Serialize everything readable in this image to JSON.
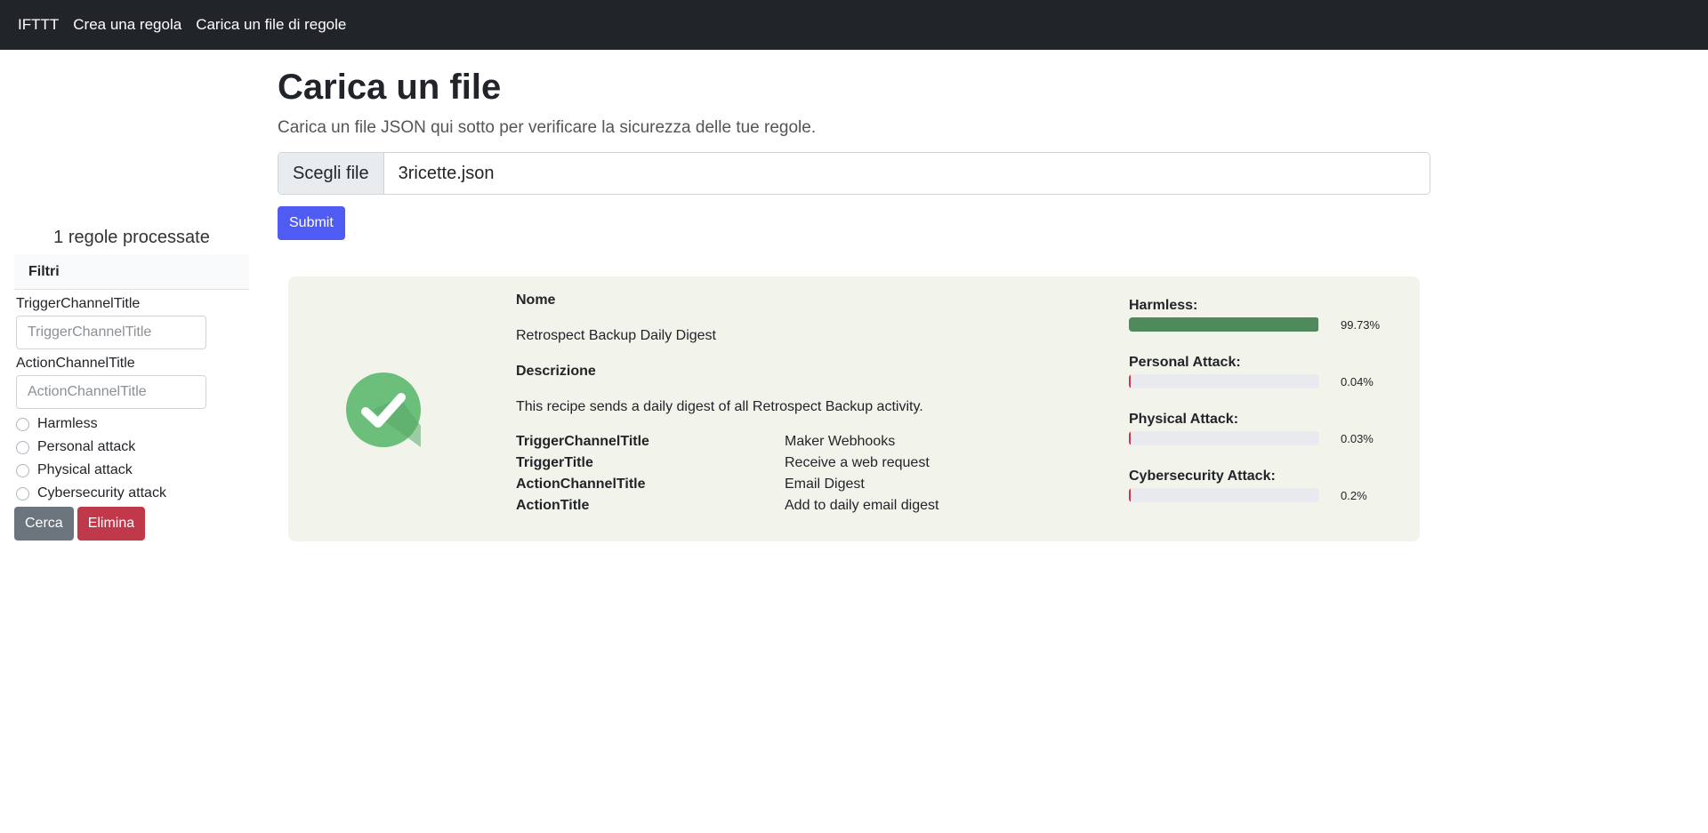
{
  "nav": {
    "brand": "IFTTT",
    "links": [
      "Crea una regola",
      "Carica un file di regole"
    ]
  },
  "sidebar": {
    "rules_count": "1 regole processate",
    "filters_title": "Filtri",
    "trigger_label": "TriggerChannelTitle",
    "trigger_placeholder": "TriggerChannelTitle",
    "action_label": "ActionChannelTitle",
    "action_placeholder": "ActionChannelTitle",
    "radios": [
      "Harmless",
      "Personal attack",
      "Physical attack",
      "Cybersecurity attack"
    ],
    "search_button": "Cerca",
    "delete_button": "Elimina"
  },
  "main": {
    "title": "Carica un file",
    "lead": "Carica un file JSON qui sotto per verificare la sicurezza delle tue regole.",
    "file_button": "Scegli file",
    "file_name": "3ricette.json",
    "submit": "Submit"
  },
  "result": {
    "icon": "check-circle-icon",
    "name_label": "Nome",
    "name": "Retrospect Backup Daily Digest",
    "description_label": "Descrizione",
    "description": "This recipe sends a daily digest of all Retrospect Backup activity.",
    "fields": [
      {
        "key": "TriggerChannelTitle",
        "value": "Maker Webhooks"
      },
      {
        "key": "TriggerTitle",
        "value": "Receive a web request"
      },
      {
        "key": "ActionChannelTitle",
        "value": "Email Digest"
      },
      {
        "key": "ActionTitle",
        "value": "Add to daily email digest"
      }
    ],
    "scores": [
      {
        "label": "Harmless:",
        "value_text": "99.73%",
        "percent": 99.73,
        "color": "#4e8a5c"
      },
      {
        "label": "Personal Attack:",
        "value_text": "0.04%",
        "percent": 0.04,
        "color": "#c0394a"
      },
      {
        "label": "Physical Attack:",
        "value_text": "0.03%",
        "percent": 0.03,
        "color": "#c0394a"
      },
      {
        "label": "Cybersecurity Attack:",
        "value_text": "0.2%",
        "percent": 0.2,
        "color": "#c0394a"
      }
    ]
  },
  "colors": {
    "navbar": "#212529",
    "primary": "#4f5bf3",
    "secondary": "#6c757d",
    "danger": "#c0394a",
    "card_bg": "#f2f3ea",
    "check_green": "#6bbf7a"
  }
}
